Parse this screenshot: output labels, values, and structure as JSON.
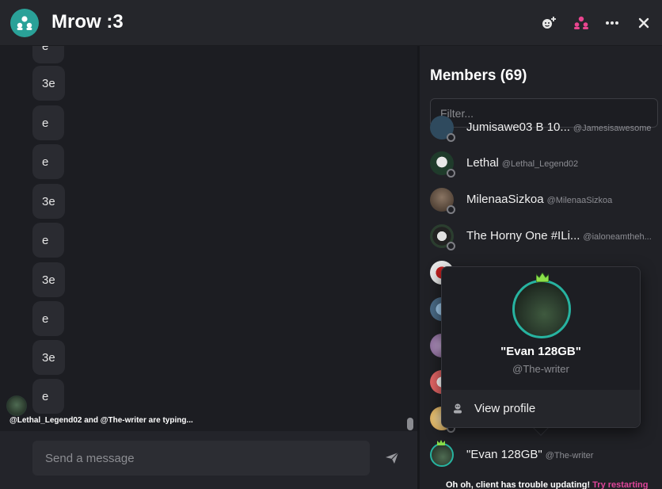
{
  "header": {
    "title": "Mrow :3",
    "avatar_icon": "group-icon",
    "buttons": [
      {
        "name": "add-user-icon",
        "color": "#e8e8e8"
      },
      {
        "name": "members-icon",
        "color": "#e9458f"
      },
      {
        "name": "more-icon",
        "color": "#e8e8e8"
      },
      {
        "name": "close-icon",
        "color": "#e8e8e8"
      }
    ]
  },
  "chat": {
    "messages": [
      "e",
      "3e",
      "e",
      "e",
      "3e",
      "e",
      "3e",
      "e",
      "3e",
      "e"
    ],
    "typing_text": "@Lethal_Legend02 and @The-writer are typing...",
    "composer_placeholder": "Send a message"
  },
  "members": {
    "title": "Members (69)",
    "filter_placeholder": "Filter...",
    "list": [
      {
        "name": "Jumisawe03 B 10...",
        "handle": "@Jamesisawesome",
        "avatar_color": "#2f4a5e"
      },
      {
        "name": "Lethal",
        "handle": "@Lethal_Legend02",
        "avatar_color": "#1f3b2b"
      },
      {
        "name": "MilenaaSizkoa",
        "handle": "@MilenaaSizkoa",
        "avatar_color": "#6b5a4a"
      },
      {
        "name": "The Horny One #ILi...",
        "handle": "@ialoneamtheh...",
        "avatar_color": "#2b3e2f"
      },
      {
        "name": "",
        "handle": "",
        "avatar_color": "#d8d8d8"
      },
      {
        "name": "",
        "handle": "",
        "avatar_color": "#4a6a86"
      },
      {
        "name": "",
        "handle": "",
        "avatar_color": "#9a7aa8"
      },
      {
        "name": "",
        "handle": "",
        "avatar_color": "#e06464"
      },
      {
        "name": "",
        "handle": "",
        "avatar_color": "#e8c070"
      },
      {
        "name": "\"Evan 128GB\"",
        "handle": "@The-writer",
        "avatar_color": "#3a5a3e"
      }
    ],
    "notice_prefix": "Oh oh, client has trouble updating!",
    "notice_action": "Try restarting"
  },
  "popup": {
    "name": "\"Evan 128GB\"",
    "handle": "@The-writer",
    "action_label": "View profile",
    "action_icon": "user-icon",
    "accent": "#27b3a0"
  }
}
